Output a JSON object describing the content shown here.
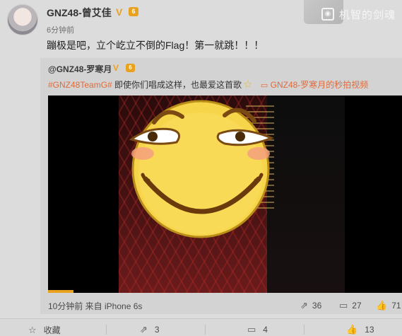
{
  "post": {
    "username": "GNZ48-曾艾佳",
    "verified_mark": "V",
    "level_badge": "6",
    "time": "6分钟前",
    "content": "蹦极是吧，立个屹立不倒的Flag！第一就跳！！！"
  },
  "watermark": {
    "icon": "camera-icon",
    "text": "机智的剑魂"
  },
  "repost": {
    "username": "@GNZ48-罗寒月",
    "verified_mark": "V",
    "level_badge": "6",
    "hashtag": "#GNZ48TeamG#",
    "text": "即使你们唱成这样，也最爱这首歌",
    "video_link": "GNZ48-罗寒月的秒拍视频",
    "source": "10分钟前 来自 iPhone 6s",
    "reposts": "36",
    "comments": "27",
    "likes": "71"
  },
  "actions": {
    "collect": "收藏",
    "repost": "3",
    "comment": "4",
    "like": "13"
  },
  "colors": {
    "accent": "#e06a3b",
    "badge": "#e8a21f",
    "background": "#dcdcdc"
  }
}
